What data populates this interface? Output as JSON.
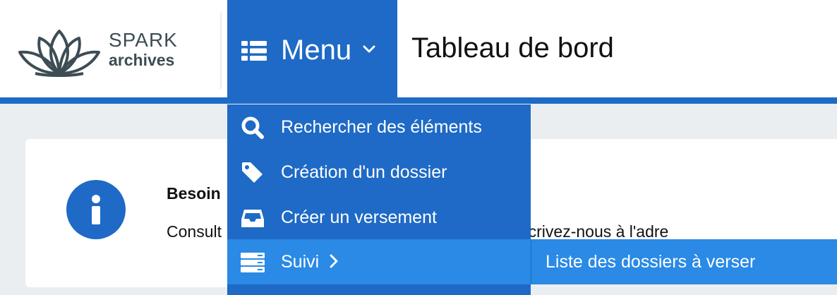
{
  "brand": {
    "line1": "SPARK",
    "line2": "archives"
  },
  "header": {
    "menu_label": "Menu",
    "page_title": "Tableau de bord"
  },
  "colors": {
    "primary": "#1e6ac6",
    "active": "#2a8ae6",
    "background": "#ebeef1"
  },
  "menu": {
    "items": [
      {
        "label": "Rechercher des éléments",
        "icon": "search-icon"
      },
      {
        "label": "Création d'un dossier",
        "icon": "tag-icon"
      },
      {
        "label": "Créer un versement",
        "icon": "inbox-icon"
      },
      {
        "label": "Suivi",
        "icon": "server-icon",
        "active": true
      }
    ],
    "submenu": {
      "items": [
        {
          "label": "Liste des dossiers à verser"
        }
      ]
    }
  },
  "card": {
    "title": "Besoin",
    "text": "Consult                                      e: olgah2020) ou écrivez-nous à l'adre"
  }
}
